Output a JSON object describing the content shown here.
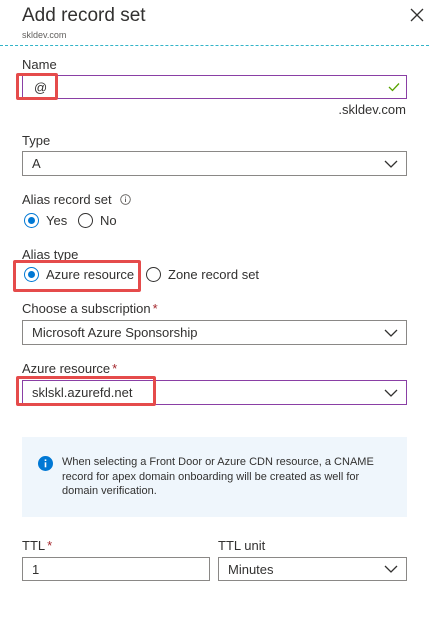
{
  "header": {
    "title": "Add record set",
    "subtitle": "skldev.com",
    "close_icon": "close-icon"
  },
  "name": {
    "label": "Name",
    "value": "@",
    "suffix": ".skldev.com",
    "valid_icon": "checkmark-icon"
  },
  "type": {
    "label": "Type",
    "value": "A"
  },
  "alias_record_set": {
    "label": "Alias record set",
    "info_icon": "info-icon",
    "options": [
      "Yes",
      "No"
    ],
    "selected": "Yes"
  },
  "alias_type": {
    "label": "Alias type",
    "options": [
      "Azure resource",
      "Zone record set"
    ],
    "selected": "Azure resource"
  },
  "subscription": {
    "label": "Choose a subscription",
    "required_mark": "*",
    "value": "Microsoft Azure Sponsorship"
  },
  "azure_resource": {
    "label": "Azure resource",
    "required_mark": "*",
    "value": "sklskl.azurefd.net"
  },
  "info_message": {
    "icon": "info-circle-icon",
    "text": "When selecting a Front Door or Azure CDN resource, a CNAME record for apex domain onboarding will be created as well for domain verification."
  },
  "ttl": {
    "label": "TTL",
    "required_mark": "*",
    "value": "1"
  },
  "ttl_unit": {
    "label": "TTL unit",
    "value": "Minutes"
  },
  "colors": {
    "accent": "#0078d4",
    "highlight": "#e54b4b",
    "focus_border": "#8a3fa5",
    "valid": "#57a300",
    "info_background": "#eff6fc"
  }
}
